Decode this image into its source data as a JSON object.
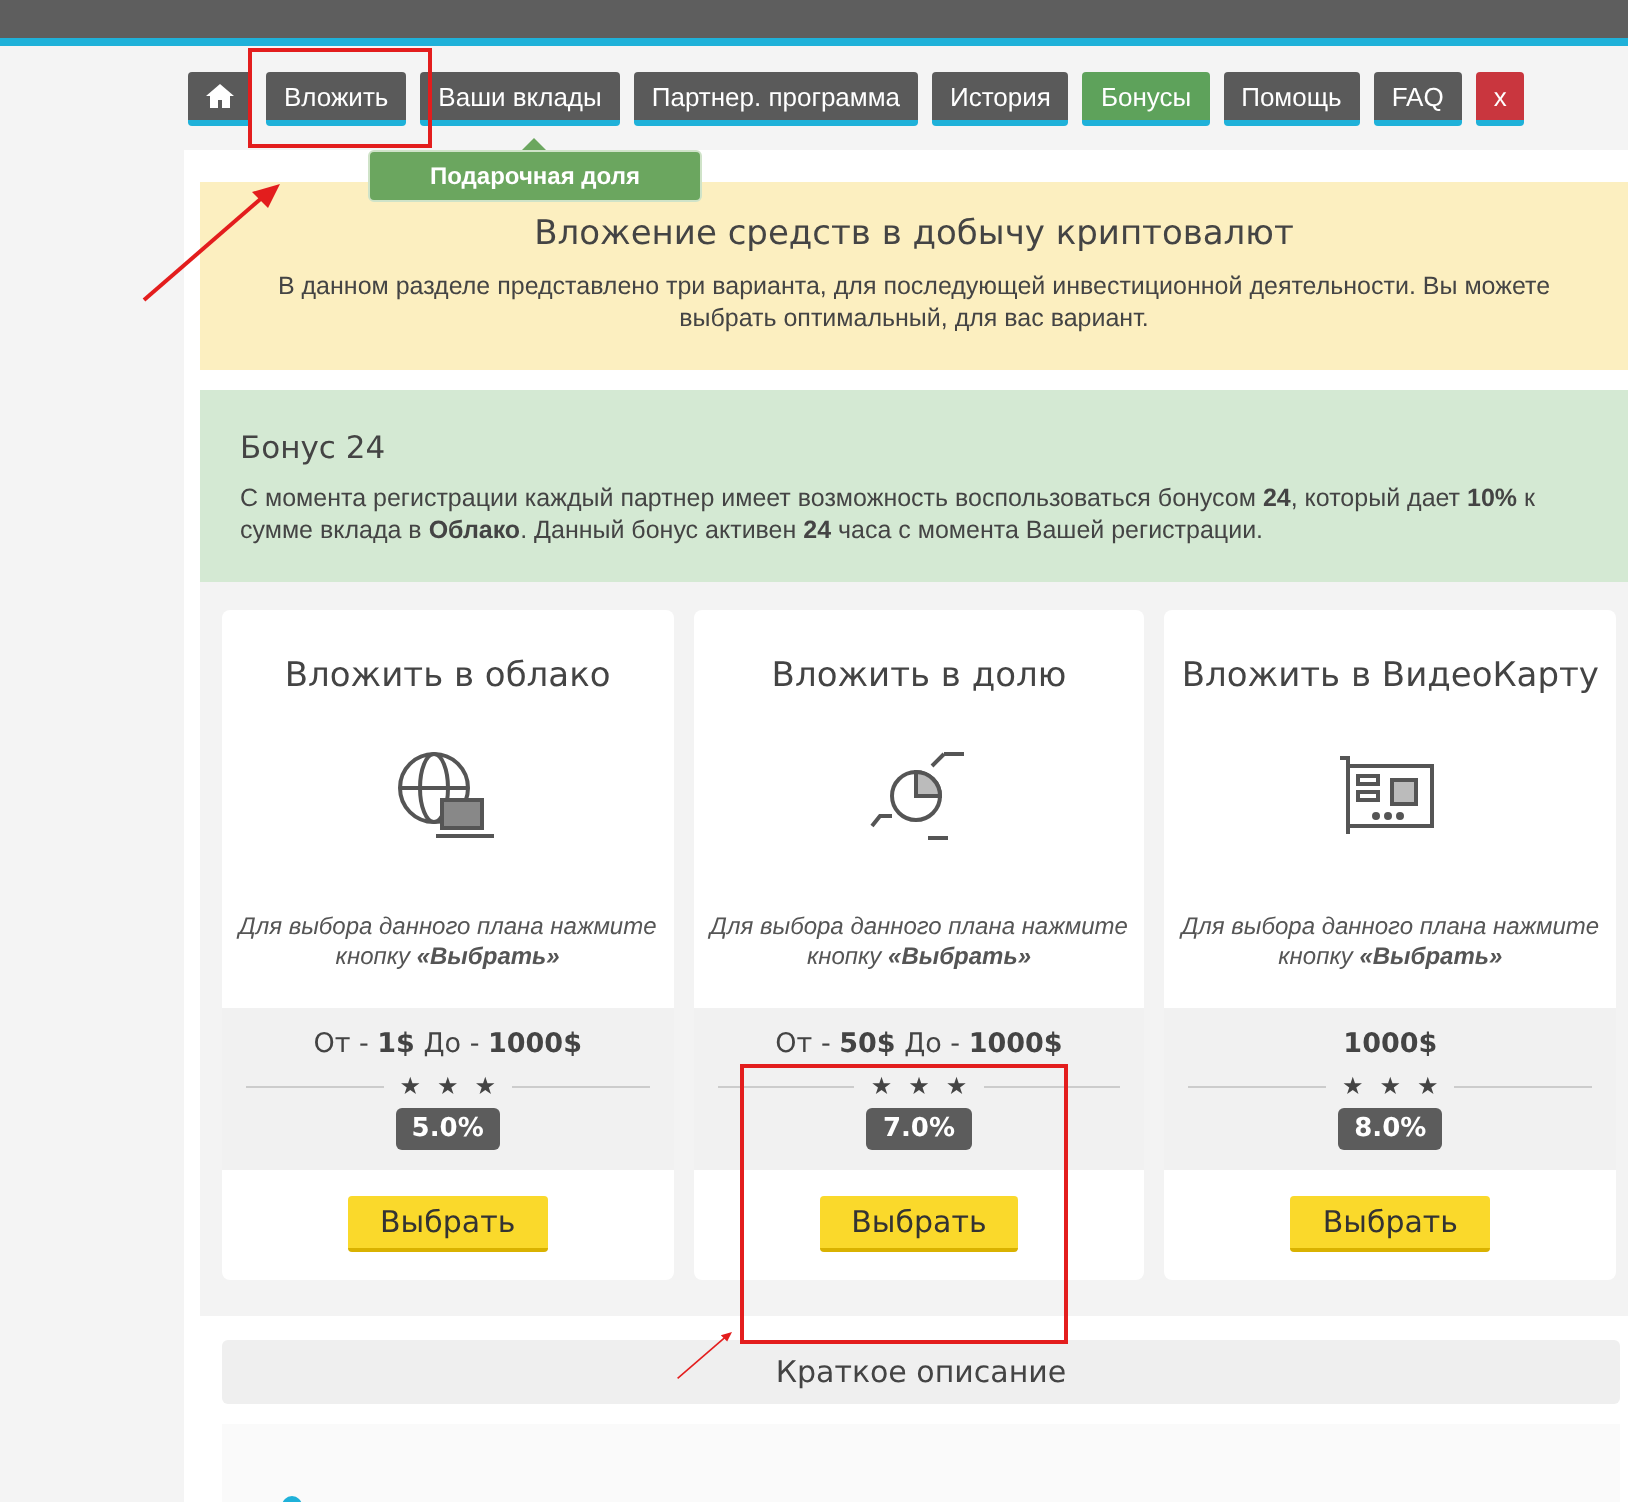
{
  "nav": {
    "items": [
      {
        "kind": "home",
        "color": "#5a5a5a"
      },
      {
        "kind": "text",
        "label": "Вложить",
        "color": "#5a5a5a"
      },
      {
        "kind": "text",
        "label": "Ваши вклады",
        "color": "#5a5a5a"
      },
      {
        "kind": "text",
        "label": "Партнер. программа",
        "color": "#5a5a5a"
      },
      {
        "kind": "text",
        "label": "История",
        "color": "#5a5a5a"
      },
      {
        "kind": "text",
        "label": "Бонусы",
        "color": "#5ea25b"
      },
      {
        "kind": "text",
        "label": "Помощь",
        "color": "#5a5a5a"
      },
      {
        "kind": "text",
        "label": "FAQ",
        "color": "#5a5a5a"
      },
      {
        "kind": "text",
        "label": "x",
        "color": "#c9363e"
      }
    ],
    "tooltip": "Подарочная доля"
  },
  "intro": {
    "title": "Вложение средств в добычу криптовалют",
    "text": "В данном разделе представлено три варианта, для последующей инвестиционной деятельности. Вы можете выбрать оптимальный, для вас вариант."
  },
  "bonus": {
    "title": "Бонус 24",
    "text": "С момента регистрации каждый партнер имеет возможность воспользоваться бонусом **24**, который дает **10%** к сумме вклада в **Облако**. Данный бонус активен **24** часа с момента Вашей регистрации."
  },
  "plans": [
    {
      "kind": "cloud",
      "title": "Вложить в облако",
      "hint": "Для выбора данного плана нажмите кнопку **«Выбрать»**",
      "range": "От - **1$** До - **1000$**",
      "stars": 3,
      "rate": "5.0%",
      "button": "Выбрать"
    },
    {
      "kind": "share",
      "title": "Вложить в долю",
      "hint": "Для выбора данного плана нажмите кнопку **«Выбрать»**",
      "range": "От - **50$** До - **1000$**",
      "stars": 3,
      "rate": "7.0%",
      "button": "Выбрать"
    },
    {
      "kind": "gpu",
      "title": "Вложить в ВидеоКарту",
      "hint": "Для выбора данного плана нажмите кнопку **«Выбрать»**",
      "range": "**1000$**",
      "stars": 3,
      "rate": "8.0%",
      "button": "Выбрать"
    }
  ],
  "summary": {
    "title": "Краткое описание"
  }
}
